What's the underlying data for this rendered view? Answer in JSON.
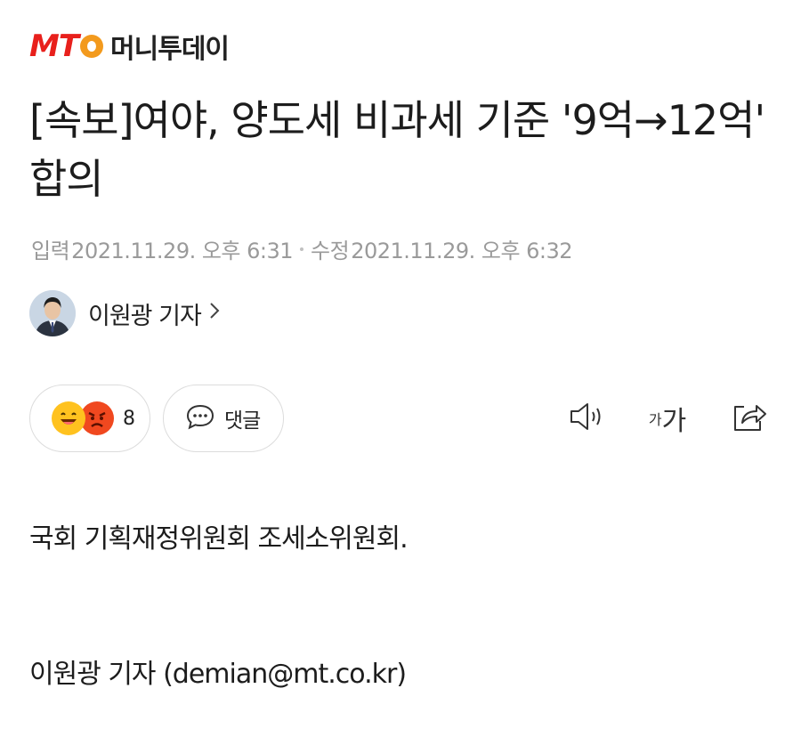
{
  "brand": {
    "logo_text": "MT",
    "name": "머니투데이",
    "accent_red": "#e8201c",
    "accent_orange": "#f39a1d"
  },
  "article": {
    "headline": "[속보]여야, 양도세 비과세 기준 '9억→12억' 합의",
    "input_label": "입력",
    "input_time": "2021.11.29. 오후 6:31",
    "modified_label": "수정",
    "modified_time": "2021.11.29. 오후 6:32",
    "author": "이원광 기자",
    "body": "국회 기획재정위원회 조세소위원회.",
    "byline": "이원광 기자 (demian@mt.co.kr)"
  },
  "actions": {
    "reaction_count": "8",
    "comment_label": "댓글",
    "font_small": "가",
    "font_big": "가",
    "icons": [
      "smile-emoji-icon",
      "angry-emoji-icon",
      "chat-bubble-icon",
      "speaker-icon",
      "font-size-icon",
      "share-icon"
    ]
  }
}
